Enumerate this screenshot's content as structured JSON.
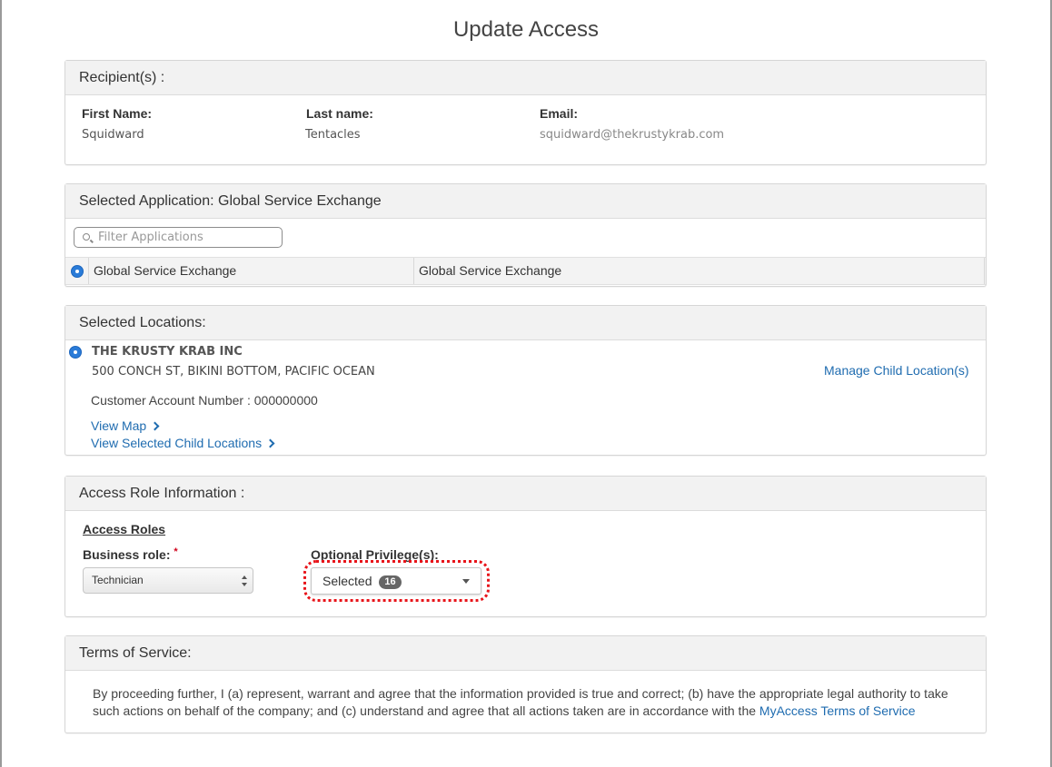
{
  "page": {
    "title": "Update Access"
  },
  "recipients": {
    "heading": "Recipient(s) :",
    "first_name_label": "First Name:",
    "first_name": "Squidward",
    "last_name_label": "Last name:",
    "last_name": "Tentacles",
    "email_label": "Email:",
    "email": "squidward@thekrustykrab.com"
  },
  "application": {
    "heading": "Selected Application: Global Service Exchange",
    "filter_placeholder": "Filter Applications",
    "row": {
      "name": "Global Service Exchange",
      "description": "Global Service Exchange"
    }
  },
  "locations": {
    "heading": "Selected Locations:",
    "company": "THE KRUSTY KRAB INC",
    "address": "500 CONCH ST, BIKINI BOTTOM, PACIFIC OCEAN",
    "account_label": "Customer Account Number :",
    "account_number": "000000000",
    "view_map": "View Map",
    "view_child_locations": "View Selected Child Locations",
    "manage_child_locations": "Manage Child Location(s)"
  },
  "access_role": {
    "heading": "Access Role Information :",
    "section_title": "Access Roles",
    "business_role_label": "Business role:",
    "required_marker": "*",
    "business_role_value": "Technician",
    "optional_label": "Optional Privilege(s):",
    "optional_value": "Selected",
    "optional_count": "16"
  },
  "terms": {
    "heading": "Terms of Service:",
    "text": "By proceeding further, I (a) represent, warrant and agree that the information provided is true and correct; (b) have the appropriate legal authority to take such actions on behalf of the company; and (c) understand and agree that all actions taken are in accordance with the",
    "link": "MyAccess Terms of Service"
  },
  "colors": {
    "link": "#1f6cb0",
    "radio": "#2a7bd8",
    "highlight": "#e8141a",
    "badge": "#666666"
  }
}
